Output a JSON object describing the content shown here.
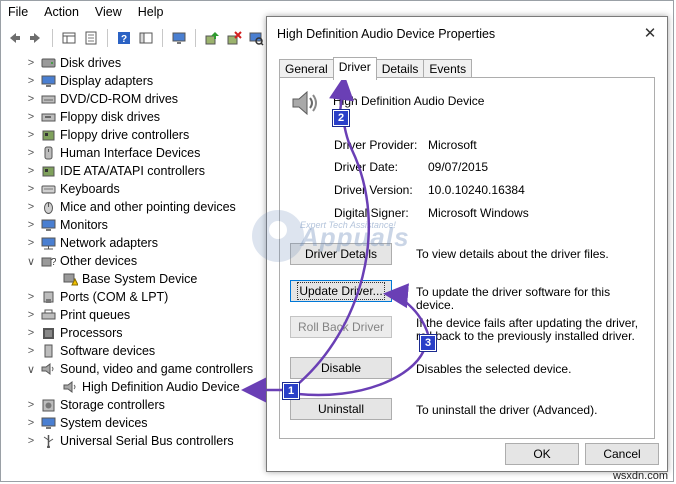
{
  "menu": [
    "File",
    "Action",
    "View",
    "Help"
  ],
  "toolbar_icons": [
    "back-icon",
    "forward-icon",
    "properties-view-icon",
    "device-list-icon",
    "help-icon",
    "console-tree-icon",
    "monitor-icon",
    "update-driver-icon",
    "uninstall-icon",
    "scan-hardware-icon"
  ],
  "tree": [
    {
      "label": "Disk drives",
      "icon": "disk-icon",
      "expanded": false,
      "level": 0
    },
    {
      "label": "Display adapters",
      "icon": "display-icon",
      "expanded": false,
      "level": 0
    },
    {
      "label": "DVD/CD-ROM drives",
      "icon": "dvd-icon",
      "expanded": false,
      "level": 0
    },
    {
      "label": "Floppy disk drives",
      "icon": "floppy-icon",
      "expanded": false,
      "level": 0
    },
    {
      "label": "Floppy drive controllers",
      "icon": "floppy-controller-icon",
      "expanded": false,
      "level": 0
    },
    {
      "label": "Human Interface Devices",
      "icon": "hid-icon",
      "expanded": false,
      "level": 0
    },
    {
      "label": "IDE ATA/ATAPI controllers",
      "icon": "ide-icon",
      "expanded": false,
      "level": 0
    },
    {
      "label": "Keyboards",
      "icon": "keyboard-icon",
      "expanded": false,
      "level": 0
    },
    {
      "label": "Mice and other pointing devices",
      "icon": "mouse-icon",
      "expanded": false,
      "level": 0
    },
    {
      "label": "Monitors",
      "icon": "monitor-icon",
      "expanded": false,
      "level": 0
    },
    {
      "label": "Network adapters",
      "icon": "network-icon",
      "expanded": false,
      "level": 0
    },
    {
      "label": "Other devices",
      "icon": "other-devices-icon",
      "expanded": true,
      "level": 0
    },
    {
      "label": "Base System Device",
      "icon": "warning-device-icon",
      "expanded": null,
      "level": 1
    },
    {
      "label": "Ports (COM & LPT)",
      "icon": "port-icon",
      "expanded": false,
      "level": 0
    },
    {
      "label": "Print queues",
      "icon": "printer-icon",
      "expanded": false,
      "level": 0
    },
    {
      "label": "Processors",
      "icon": "processor-icon",
      "expanded": false,
      "level": 0
    },
    {
      "label": "Software devices",
      "icon": "software-device-icon",
      "expanded": false,
      "level": 0
    },
    {
      "label": "Sound, video and game controllers",
      "icon": "speaker-icon",
      "expanded": true,
      "level": 0
    },
    {
      "label": "High Definition Audio Device",
      "icon": "speaker-icon",
      "expanded": null,
      "level": 1
    },
    {
      "label": "Storage controllers",
      "icon": "storage-icon",
      "expanded": false,
      "level": 0
    },
    {
      "label": "System devices",
      "icon": "system-icon",
      "expanded": false,
      "level": 0
    },
    {
      "label": "Universal Serial Bus controllers",
      "icon": "usb-icon",
      "expanded": false,
      "level": 0
    }
  ],
  "dialog": {
    "title": "High Definition Audio Device Properties",
    "close": "✕",
    "tabs": [
      "General",
      "Driver",
      "Details",
      "Events"
    ],
    "active_tab": "Driver",
    "device_name": "High Definition Audio Device",
    "info": [
      {
        "label": "Driver Provider:",
        "value": "Microsoft"
      },
      {
        "label": "Driver Date:",
        "value": "09/07/2015"
      },
      {
        "label": "Driver Version:",
        "value": "10.0.10240.16384"
      },
      {
        "label": "Digital Signer:",
        "value": "Microsoft Windows"
      }
    ],
    "buttons": [
      {
        "label": "Driver Details",
        "desc": "To view details about the driver files.",
        "state": "normal"
      },
      {
        "label": "Update Driver...",
        "desc": "To update the driver software for this device.",
        "state": "focused"
      },
      {
        "label": "Roll Back Driver",
        "desc": "If the device fails after updating the driver, roll back to the previously installed driver.",
        "state": "disabled"
      },
      {
        "label": "Disable",
        "desc": "Disables the selected device.",
        "state": "normal"
      },
      {
        "label": "Uninstall",
        "desc": "To uninstall the driver (Advanced).",
        "state": "normal"
      }
    ],
    "ok": "OK",
    "cancel": "Cancel"
  },
  "annotations": {
    "badges": [
      "1",
      "2",
      "3"
    ],
    "arrow_color": "#6a3fb5",
    "badge_color": "#2a3fc8"
  },
  "watermark": {
    "text": "Appuals",
    "subtext": "Expert Tech Assistance!"
  },
  "credit": "wsxdn.com"
}
